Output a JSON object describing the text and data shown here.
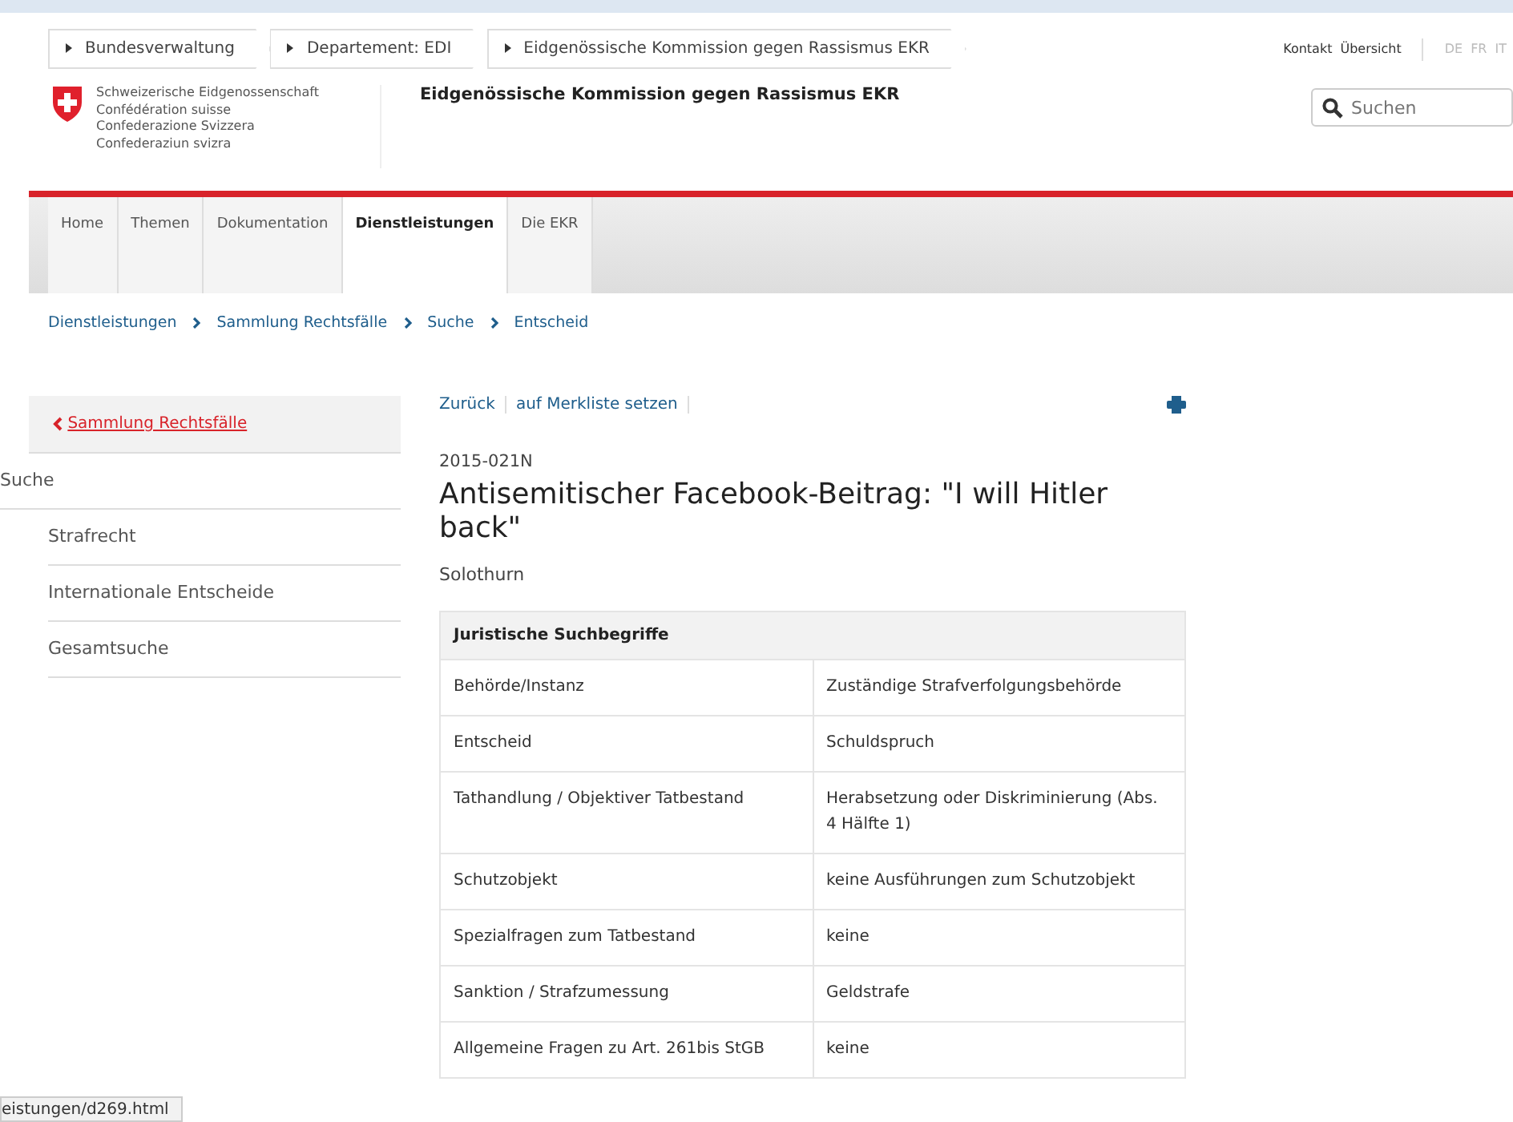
{
  "top_breadcrumb": [
    "Bundesverwaltung",
    "Departement: EDI",
    "Eidgenössische Kommission gegen Rassismus EKR"
  ],
  "meta_links": [
    "Kontakt",
    "Übersicht"
  ],
  "languages": [
    {
      "label": "DE",
      "selected": false
    },
    {
      "label": "FR",
      "selected": false
    },
    {
      "label": "IT",
      "selected": false
    }
  ],
  "logo_lines": [
    "Schweizerische Eidgenossenschaft",
    "Confédération suisse",
    "Confederazione Svizzera",
    "Confederaziun svizra"
  ],
  "site_title": "Eidgenössische Kommission gegen Rassismus EKR",
  "search": {
    "placeholder": "Suchen"
  },
  "nav_tabs": [
    {
      "label": "Home",
      "selected": false
    },
    {
      "label": "Themen",
      "selected": false
    },
    {
      "label": "Dokumentation",
      "selected": false
    },
    {
      "label": "Dienstleistungen",
      "selected": true
    },
    {
      "label": "Die EKR",
      "selected": false
    }
  ],
  "breadcrumb": [
    "Dienstleistungen",
    "Sammlung Rechtsfälle",
    "Suche",
    "Entscheid"
  ],
  "sidebar": {
    "back_link": "Sammlung Rechtsfälle",
    "heading": "Suche",
    "items": [
      "Strafrecht",
      "Internationale Entscheide",
      "Gesamtsuche"
    ]
  },
  "actions": [
    "Zurück",
    "auf Merkliste setzen"
  ],
  "case_number": "2015-021N",
  "title": "Antisemitischer Facebook-Beitrag: \"I will Hitler back\"",
  "canton": "Solothurn",
  "table": {
    "heading": "Juristische Suchbegriffe",
    "rows": [
      [
        "Behörde/Instanz",
        "Zuständige Strafverfolgungsbehörde"
      ],
      [
        "Entscheid",
        "Schuldspruch"
      ],
      [
        "Tathandlung / Objektiver Tatbestand",
        "Herabsetzung oder Diskriminierung (Abs. 4 Hälfte 1)"
      ],
      [
        "Schutzobjekt",
        "keine Ausführungen zum Schutzobjekt"
      ],
      [
        "Spezialfragen zum Tatbestand",
        "keine"
      ],
      [
        "Sanktion / Strafzumessung",
        "Geldstrafe"
      ],
      [
        "Allgemeine Fragen zu Art. 261bis StGB",
        "keine"
      ]
    ]
  },
  "status_bar": "eistungen/d269.html"
}
